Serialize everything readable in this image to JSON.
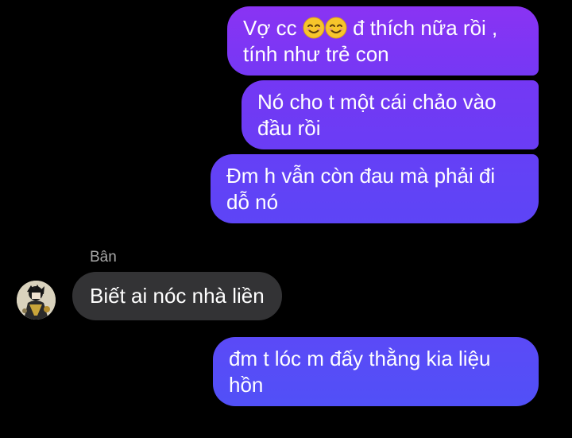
{
  "messages": [
    {
      "id": "m1",
      "direction": "outgoing",
      "lines": [
        "Vợ cc",
        "đ thích nữa rồi ,",
        "tính như trẻ con"
      ],
      "emojis": [
        "smiling-face-icon",
        "smiling-face-icon"
      ]
    },
    {
      "id": "m2",
      "direction": "outgoing",
      "lines": [
        "Nó cho t một cái chảo vào",
        "đầu rồi"
      ]
    },
    {
      "id": "m3",
      "direction": "outgoing",
      "lines": [
        "Đm h vẫn còn đau mà phải đi",
        "dỗ nó"
      ]
    },
    {
      "id": "m4",
      "direction": "incoming",
      "sender": "Bân",
      "text": "Biết ai nóc nhà liền"
    },
    {
      "id": "m5",
      "direction": "outgoing",
      "lines": [
        "đm t lóc m đấy thằng kia liệu",
        "hồn"
      ]
    }
  ],
  "colors": {
    "background": "#000000",
    "outgoing_top": "#8a33f3",
    "outgoing_bottom": "#5150f7",
    "incoming": "#333335",
    "sender_name": "#a8a8a8"
  }
}
